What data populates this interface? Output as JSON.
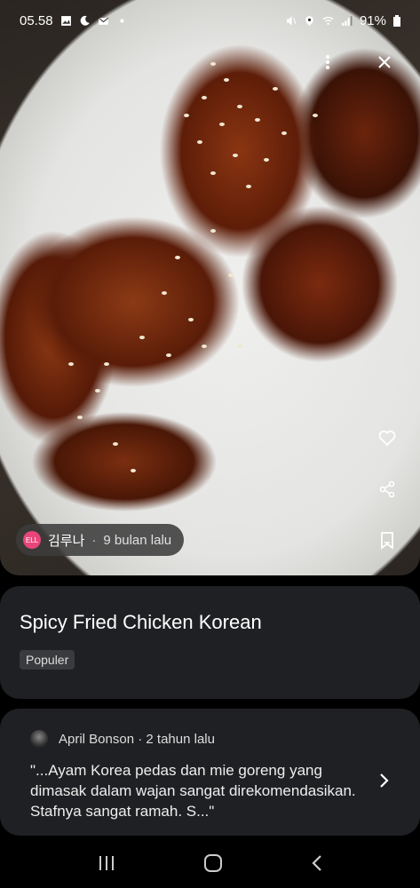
{
  "status_bar": {
    "time": "05.58",
    "battery": "91%"
  },
  "photo": {
    "author_name": "김루나",
    "author_time": "9 bulan lalu",
    "author_avatar_text": "ELL"
  },
  "place": {
    "title": "Spicy Fried Chicken Korean",
    "tag": "Populer"
  },
  "review": {
    "author": "April Bonson",
    "time": "2 tahun lalu",
    "text": "\"...Ayam Korea pedas dan mie goreng yang dimasak dalam wajan sangat direkomendasikan. Stafnya sangat ramah. S...\""
  },
  "icons": {
    "more": "more-vert-icon",
    "close": "close-icon",
    "like": "heart-icon",
    "share": "share-icon",
    "save": "bookmark-icon",
    "next": "chevron-right-icon"
  }
}
